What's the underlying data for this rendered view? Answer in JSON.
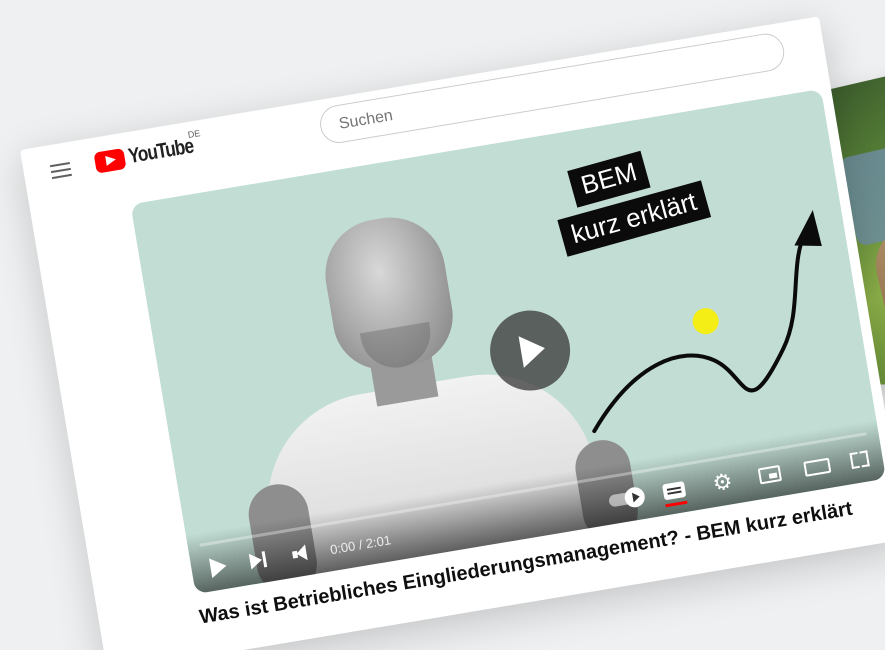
{
  "header": {
    "logo_text": "YouTube",
    "country_code": "DE",
    "search_placeholder": "Suchen"
  },
  "video": {
    "thumbnail_text_line1": "BEM",
    "thumbnail_text_line2": "kurz erklärt",
    "time_display": "0:00 / 2:01",
    "progress_fraction": 0.0,
    "title": "Was ist Betriebliches Eingliederungsmanagement? - BEM kurz erklärt"
  },
  "colors": {
    "brand_red": "#ff0000",
    "video_background": "#c2ded4",
    "dot_yellow": "#f4ee16"
  },
  "icons": {
    "menu": "hamburger-menu-icon",
    "logo": "youtube-logo-icon",
    "play": "play-icon",
    "next": "next-icon",
    "volume": "volume-icon",
    "autoplay": "autoplay-toggle-icon",
    "subtitles": "subtitles-icon",
    "settings": "gear-icon",
    "miniplayer": "miniplayer-icon",
    "theater": "theater-mode-icon",
    "fullscreen": "fullscreen-icon"
  }
}
